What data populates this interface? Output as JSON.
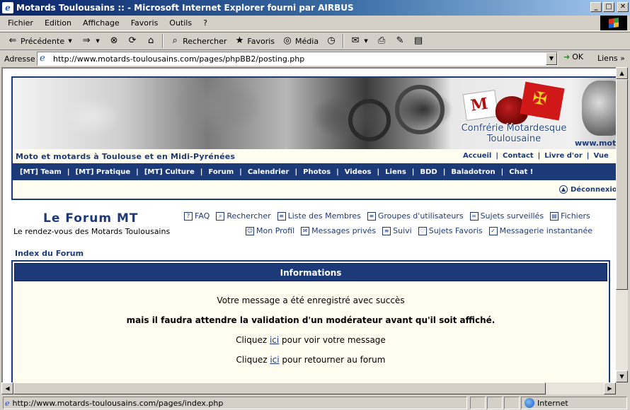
{
  "window": {
    "title": "Motards Toulousains :: - Microsoft Internet Explorer fourni par AIRBUS",
    "controls": [
      "_",
      "□",
      "✕"
    ]
  },
  "menu": [
    "Fichier",
    "Edition",
    "Affichage",
    "Favoris",
    "Outils",
    "?"
  ],
  "toolbar": {
    "back": "Précédente",
    "search": "Rechercher",
    "favorites": "Favoris",
    "media": "Média"
  },
  "address": {
    "label": "Adresse",
    "url": "http://www.motards-toulousains.com/pages/phpBB2/posting.php",
    "go": "OK",
    "links": "Liens"
  },
  "banner": {
    "logo_title": "Confrérie Motardesque Toulousaine",
    "www": "www.mota",
    "flag_letter": "M",
    "cross_glyph": "✠"
  },
  "site": {
    "tagline": "Moto et motards à Toulouse et en Midi-Pyrénées",
    "top_links": [
      "Accueil",
      "Contact",
      "Livre d'or",
      "Vue"
    ],
    "nav": [
      "[MT] Team",
      "[MT] Pratique",
      "[MT] Culture",
      "Forum",
      "Calendrier",
      "Photos",
      "Videos",
      "Liens",
      "BDD",
      "Baladotron",
      "Chat !"
    ],
    "logout": "Déconnexion"
  },
  "forum": {
    "title": "Le Forum MT",
    "subtitle": "Le rendez-vous des Motards Toulousains",
    "nav_row1": [
      {
        "label": "FAQ",
        "icon": "?"
      },
      {
        "label": "Rechercher",
        "icon": "⌕"
      },
      {
        "label": "Liste des Membres",
        "icon": "≡"
      },
      {
        "label": "Groupes d'utilisateurs",
        "icon": "≡"
      },
      {
        "label": "Sujets surveillés",
        "icon": "∞"
      },
      {
        "label": "Fichiers",
        "icon": "▤"
      }
    ],
    "nav_row2": [
      {
        "label": "Mon Profil",
        "icon": "☺"
      },
      {
        "label": "Messages privés",
        "icon": "✉"
      },
      {
        "label": "Suivi",
        "icon": "≡"
      },
      {
        "label": "Sujets Favoris",
        "icon": "♡"
      },
      {
        "label": "Messagerie instantanée",
        "icon": "✓"
      }
    ],
    "index_link": "Index du Forum"
  },
  "info": {
    "header": "Informations",
    "line1": "Votre message a été enregistré avec succès",
    "line2": "mais il faudra attendre la validation d'un modérateur avant qu'il soit affiché.",
    "line3_pre": "Cliquez ",
    "line3_link": "ici",
    "line3_post": " pour voir votre message",
    "line4_pre": "Cliquez ",
    "line4_link": "ici",
    "line4_post": " pour retourner au forum"
  },
  "status": {
    "text": "http://www.motards-toulousains.com/pages/index.php",
    "zone": "Internet"
  }
}
